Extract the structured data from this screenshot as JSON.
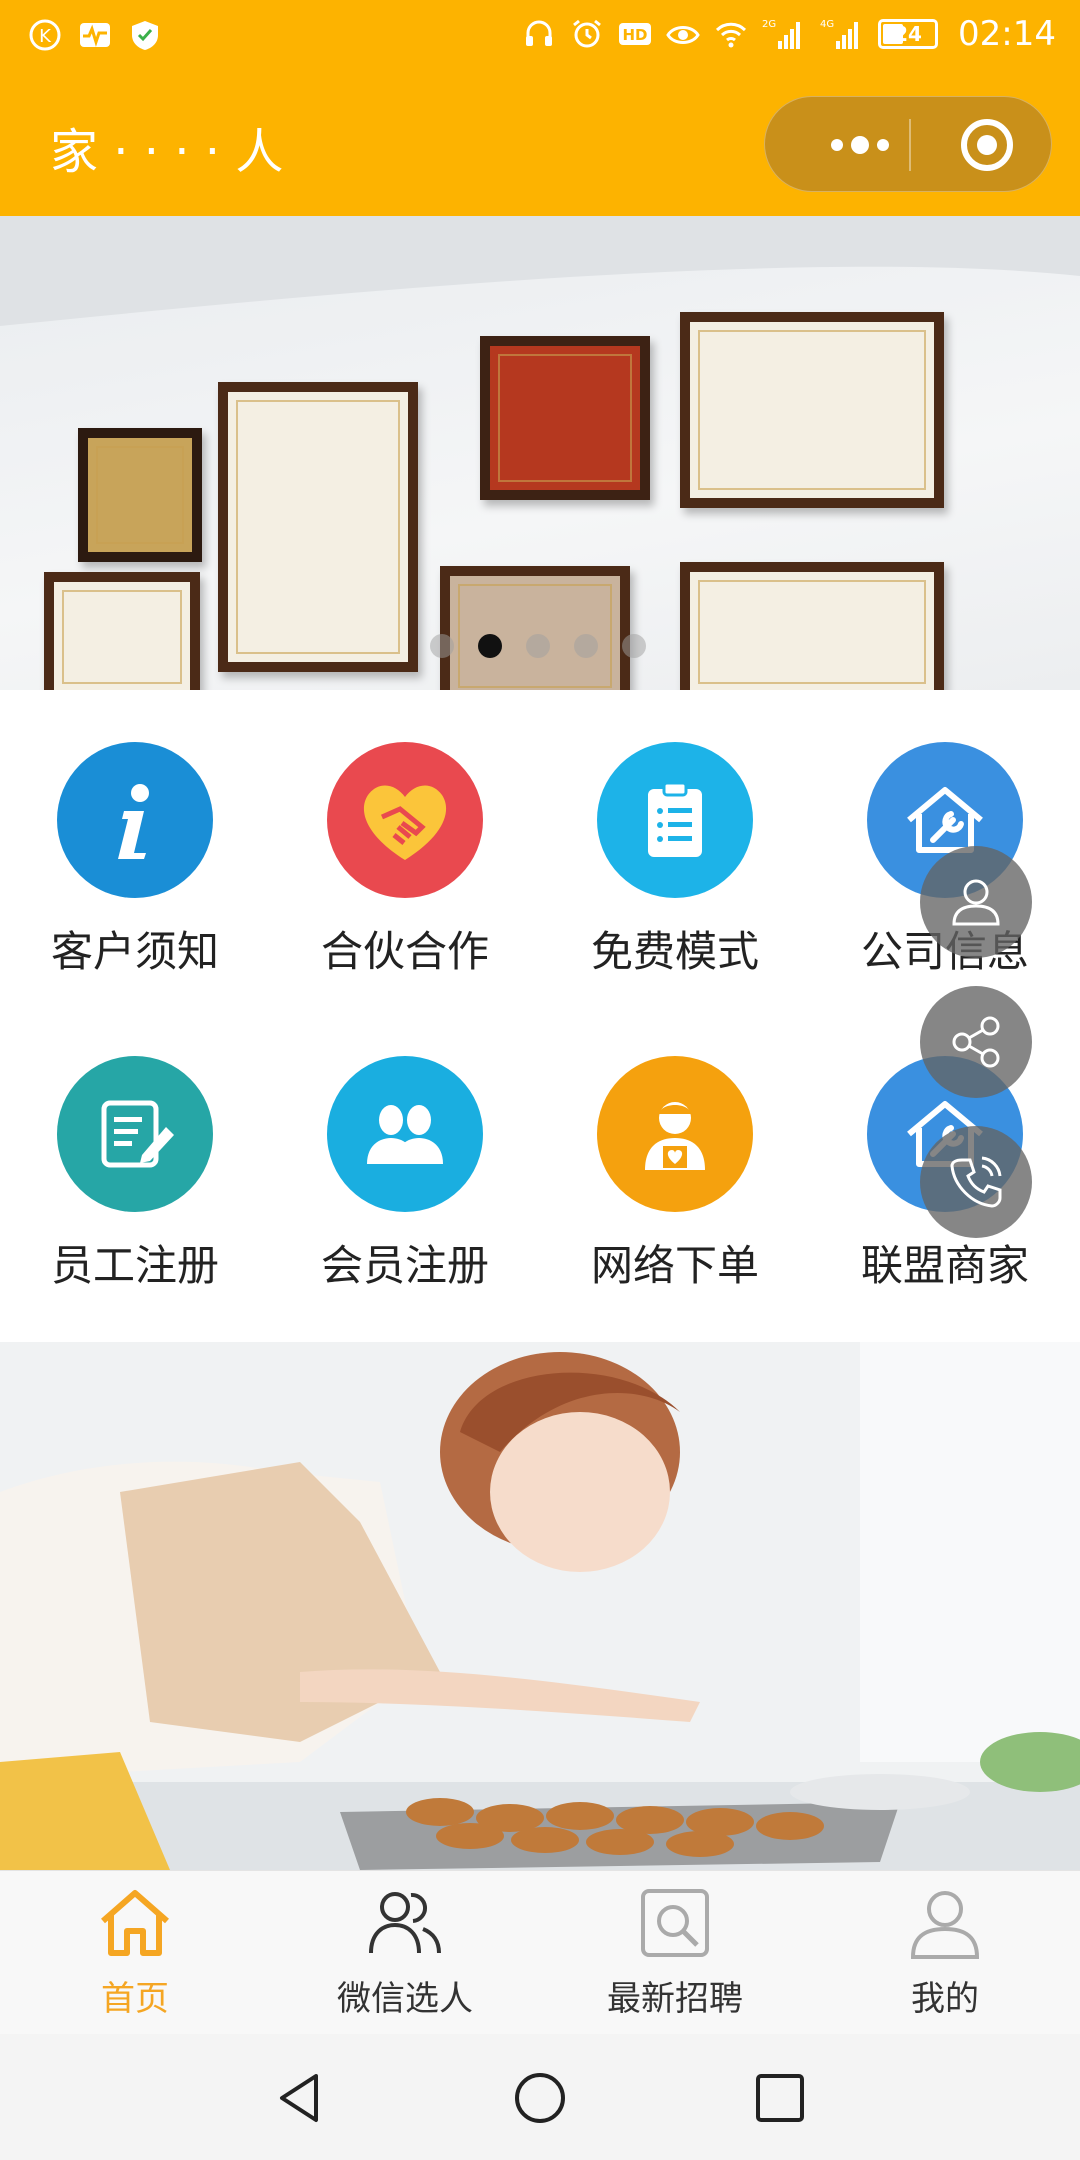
{
  "status_bar": {
    "time": "02:14",
    "battery": "24",
    "network_1": "2G",
    "network_2": "4G"
  },
  "header": {
    "title": "家 · · · · 人"
  },
  "banner": {
    "slide_count": 5,
    "active_index": 1
  },
  "menu": [
    {
      "label": "客户须知",
      "icon": "info-icon",
      "color": "#1A8ED6"
    },
    {
      "label": "合伙合作",
      "icon": "handshake-heart-icon",
      "color": "#E9494F"
    },
    {
      "label": "免费模式",
      "icon": "clipboard-icon",
      "color": "#1DB3E8"
    },
    {
      "label": "公司信息",
      "icon": "house-tools-icon",
      "color": "#3A90E0"
    },
    {
      "label": "员工注册",
      "icon": "edit-document-icon",
      "color": "#26A6A6"
    },
    {
      "label": "会员注册",
      "icon": "group-icon",
      "color": "#1AAEE0"
    },
    {
      "label": "网络下单",
      "icon": "maid-icon",
      "color": "#F5A10E"
    },
    {
      "label": "联盟商家",
      "icon": "house-tools-icon",
      "color": "#3A90E0"
    }
  ],
  "tabs": [
    {
      "label": "首页",
      "icon": "home-icon",
      "active": true
    },
    {
      "label": "微信选人",
      "icon": "people-icon",
      "active": false
    },
    {
      "label": "最新招聘",
      "icon": "search-doc-icon",
      "active": false
    },
    {
      "label": "我的",
      "icon": "user-icon",
      "active": false
    }
  ],
  "colors": {
    "brand": "#FDB300",
    "active_tab": "#F5A623"
  }
}
